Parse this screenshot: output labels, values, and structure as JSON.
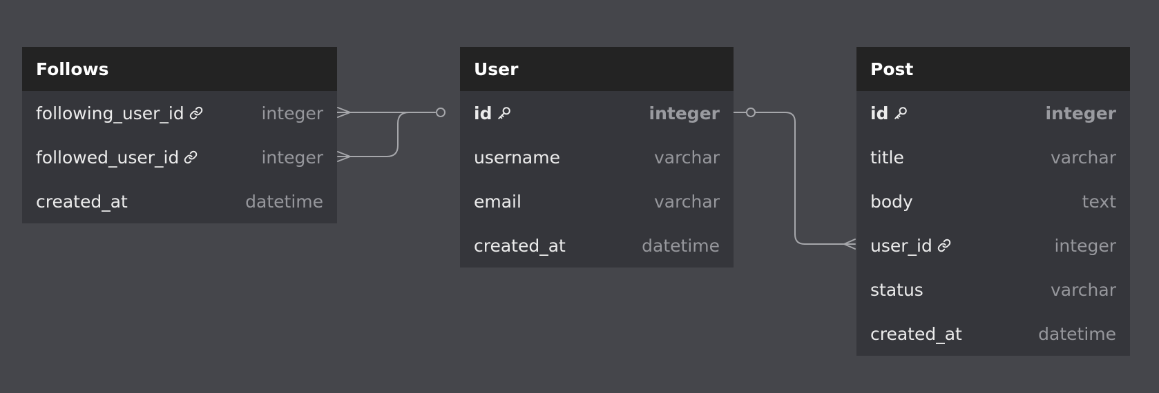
{
  "tables": {
    "follows": {
      "title": "Follows",
      "rows": [
        {
          "name": "following_user_id",
          "type": "integer",
          "icon": "link-icon"
        },
        {
          "name": "followed_user_id",
          "type": "integer",
          "icon": "link-icon"
        },
        {
          "name": "created_at",
          "type": "datetime"
        }
      ]
    },
    "user": {
      "title": "User",
      "rows": [
        {
          "name": "id",
          "type": "integer",
          "icon": "key-icon",
          "primary_key": true
        },
        {
          "name": "username",
          "type": "varchar"
        },
        {
          "name": "email",
          "type": "varchar"
        },
        {
          "name": "created_at",
          "type": "datetime"
        }
      ]
    },
    "post": {
      "title": "Post",
      "rows": [
        {
          "name": "id",
          "type": "integer",
          "icon": "key-icon",
          "primary_key": true
        },
        {
          "name": "title",
          "type": "varchar"
        },
        {
          "name": "body",
          "type": "text"
        },
        {
          "name": "user_id",
          "type": "integer",
          "icon": "link-icon"
        },
        {
          "name": "status",
          "type": "varchar"
        },
        {
          "name": "created_at",
          "type": "datetime"
        }
      ]
    }
  },
  "relationships": [
    {
      "from": "Follows.following_user_id",
      "to": "User.id",
      "from_end": "many",
      "to_end": "zero-or-one"
    },
    {
      "from": "Follows.followed_user_id",
      "to": "User.id",
      "from_end": "many",
      "to_end": "zero-or-one"
    },
    {
      "from": "Post.user_id",
      "to": "User.id",
      "from_end": "many",
      "to_end": "zero-or-one"
    }
  ],
  "colors": {
    "canvas": "#45464b",
    "table_body": "#35363b",
    "table_header": "#232323",
    "text": "#ececec",
    "type_text": "#96979c",
    "connector": "#a6a7ab"
  }
}
